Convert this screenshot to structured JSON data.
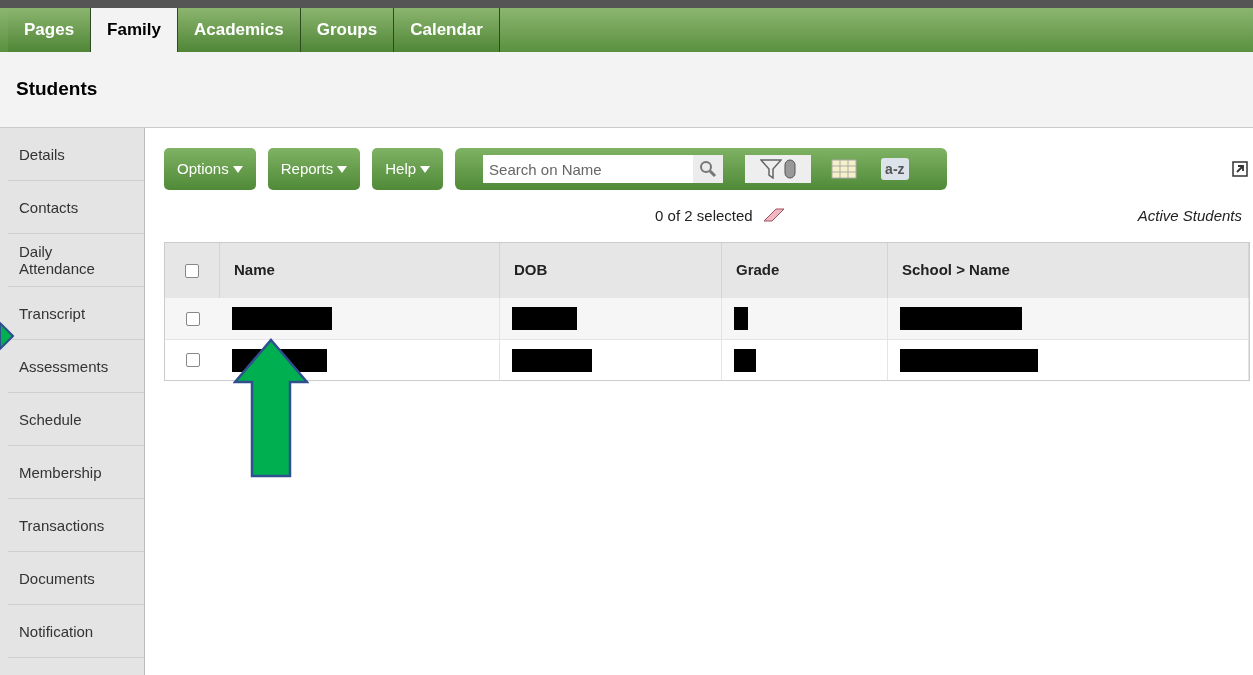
{
  "tabs": [
    {
      "label": "Pages",
      "selected": false
    },
    {
      "label": "Family",
      "selected": true
    },
    {
      "label": "Academics",
      "selected": false
    },
    {
      "label": "Groups",
      "selected": false
    },
    {
      "label": "Calendar",
      "selected": false
    }
  ],
  "page_title": "Students",
  "sidebar": {
    "items": [
      "Details",
      "Contacts",
      "Daily Attendance",
      "Transcript",
      "Assessments",
      "Schedule",
      "Membership",
      "Transactions",
      "Documents",
      "Notification"
    ]
  },
  "toolbar": {
    "menus": [
      "Options",
      "Reports",
      "Help"
    ],
    "search": {
      "placeholder": "Search on Name"
    },
    "sort_label": "a-z"
  },
  "selection_status": "0 of 2 selected",
  "filter_label": "Active Students",
  "table": {
    "select_all": {
      "checked": false
    },
    "columns": [
      "Name",
      "DOB",
      "Grade",
      "School > Name"
    ],
    "rows": [
      {
        "checked": false
      },
      {
        "checked": false
      }
    ]
  }
}
